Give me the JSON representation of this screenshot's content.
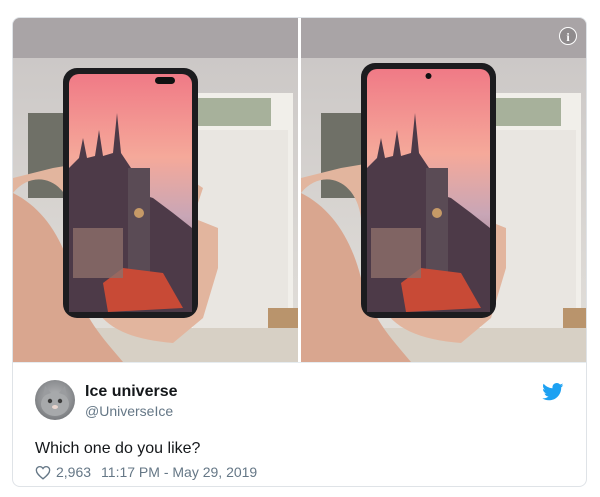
{
  "author": {
    "name": "Ice universe",
    "handle": "@UniverseIce"
  },
  "tweet": {
    "text": "Which one do you like?",
    "likes": "2,963",
    "timestamp": "11:17 PM - May 29, 2019"
  },
  "icons": {
    "info": "info-icon",
    "brand": "twitter-bird-icon",
    "like": "heart-icon"
  },
  "colors": {
    "brand_blue": "#1da1f2",
    "text": "#14171a",
    "muted": "#657786"
  }
}
